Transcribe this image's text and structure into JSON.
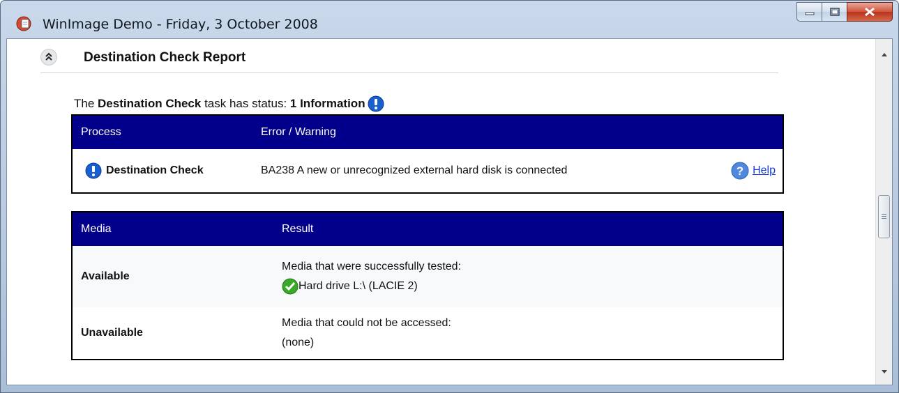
{
  "window": {
    "title": "WinImage Demo - Friday, 3 October 2008",
    "minimize_label": "",
    "maximize_label": "",
    "close_label": "x"
  },
  "section": {
    "title": "Destination Check Report"
  },
  "status": {
    "prefix": "The ",
    "task_name": "Destination Check",
    "middle": " task has status: ",
    "value": "1 Information"
  },
  "process_table": {
    "headers": [
      "Process",
      "Error / Warning"
    ],
    "rows": [
      {
        "process": "Destination Check",
        "message": "BA238 A new or unrecognized external hard disk is connected",
        "help_label": "Help"
      }
    ]
  },
  "media_table": {
    "headers": [
      "Media",
      "Result"
    ],
    "rows": [
      {
        "media": "Available",
        "result_heading": "Media that were successfully tested:",
        "result_item": "Hard drive L:\\ (LACIE 2)"
      },
      {
        "media": "Unavailable",
        "result_heading": "Media that could not be accessed:",
        "result_item": "(none)"
      }
    ]
  },
  "colors": {
    "header_bg": "#02008a",
    "link": "#1a3fd8",
    "info_icon": "#1a5fd0",
    "check_icon": "#3aa829"
  },
  "icons": {
    "app": "winimage-app-icon",
    "info": "info-icon",
    "help": "help-question-icon",
    "check": "check-icon",
    "collapse": "collapse-chevron-icon"
  }
}
